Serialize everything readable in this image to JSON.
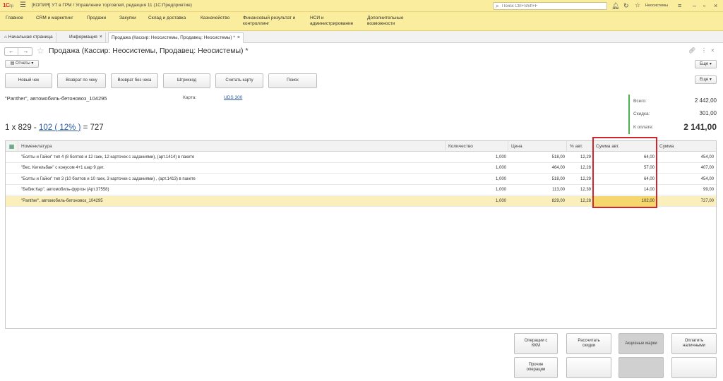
{
  "app": {
    "logo": "1С",
    "logo_sub": "пр",
    "window_title": "[КОПИЯ] УТ в ГРМ / Управление торговлей, редакция 11 (1С:Предприятие)",
    "search_placeholder": "Поиск Ctrl+Shift+F",
    "user": "Неосистемы"
  },
  "menu": [
    "Главное",
    "CRM и маркетинг",
    "Продажи",
    "Закупки",
    "Склад и доставка",
    "Казначейство",
    "Финансовый результат и контроллинг",
    "НСИ и администрирование",
    "Дополнительные возможности"
  ],
  "tabs": [
    {
      "label": "Начальная страница"
    },
    {
      "label": "Информация"
    },
    {
      "label": "Продажа (Кассир: Неосистемы, Продавец: Неосистемы) *"
    }
  ],
  "form": {
    "title": "Продажа (Кассир: Неосистемы, Продавец: Неосистемы) *",
    "reports": "Отчеты",
    "more": "Еще"
  },
  "toolbar": [
    "Новый чек",
    "Возврат по чеку",
    "Возврат без чека",
    "Штрихкод",
    "Считать карту",
    "Поиск"
  ],
  "product": {
    "name": "\"Panther\", автомобиль-бетоновоз_104295",
    "card_label": "Карта:",
    "card_value": "UDS 300",
    "calc_prefix": "1 х 829 -",
    "calc_discount": "102 ( 12% )",
    "calc_suffix": "= 727"
  },
  "totals": {
    "total_label": "Всего:",
    "total": "2 442,00",
    "discount_label": "Скидка:",
    "discount": "301,00",
    "pay_label": "К оплате:",
    "pay": "2 141,00"
  },
  "grid": {
    "columns": [
      "Номенклатура",
      "Количество",
      "Цена",
      "% авт.",
      "Сумма авт.",
      "Сумма"
    ],
    "rows": [
      {
        "name": "\"Болты и Гайки\" тип 4 (8 болтов и 12 гаек, 12  карточек с заданиями), (арт.1414) в пакете",
        "qty": "1,000",
        "price": "518,00",
        "pct": "12,29",
        "auto": "64,00",
        "sum": "454,00"
      },
      {
        "name": "\"Вес. Кегельбан\" с конусом 4+1 шар 9 дет.",
        "qty": "1,000",
        "price": "464,00",
        "pct": "12,28",
        "auto": "57,00",
        "sum": "407,00"
      },
      {
        "name": "\"Болты и Гайки\" тип 3 (10 болтов и 10 гаек, 3 карточки с заданиями) , (арт.1413) в пакете",
        "qty": "1,000",
        "price": "518,00",
        "pct": "12,29",
        "auto": "64,00",
        "sum": "454,00"
      },
      {
        "name": "\"Бебик Кар\", автомобиль-фургон (Арт.37558)",
        "qty": "1,000",
        "price": "113,00",
        "pct": "12,39",
        "auto": "14,00",
        "sum": "99,00"
      },
      {
        "name": "\"Panther\", автомобиль-бетоновоз_104295",
        "qty": "1,000",
        "price": "829,00",
        "pct": "12,28",
        "auto": "102,00",
        "sum": "727,00"
      }
    ]
  },
  "bottom": {
    "ops": "Операции с ККМ",
    "recalc": "Рассчитать скидки",
    "marks": "Акцизные марки",
    "pay_cash": "Оплатить наличными",
    "other_ops": "Прочие операции"
  }
}
